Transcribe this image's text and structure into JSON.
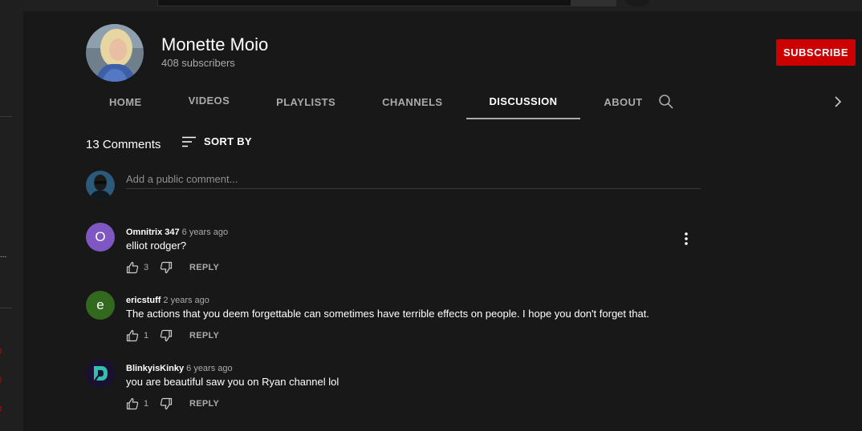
{
  "channel": {
    "name": "Monette Moio",
    "subscribers": "408 subscribers",
    "subscribe_label": "SUBSCRIBE",
    "accent_color": "#cc0000"
  },
  "tabs": [
    {
      "label": "HOME",
      "active": false
    },
    {
      "label": "VIDEOS",
      "active": false
    },
    {
      "label": "PLAYLISTS",
      "active": false
    },
    {
      "label": "CHANNELS",
      "active": false
    },
    {
      "label": "DISCUSSION",
      "active": true
    },
    {
      "label": "ABOUT",
      "active": false
    }
  ],
  "discussion": {
    "count_label": "13 Comments",
    "sort_label": "SORT BY",
    "add_comment_placeholder": "Add a public comment...",
    "reply_label": "REPLY"
  },
  "comments": [
    {
      "author": "Omnitrix 347",
      "time": "6 years ago",
      "text": "elliot rodger?",
      "likes": "3",
      "avatar_letter": "O",
      "avatar_color": "#7e57c2"
    },
    {
      "author": "ericstuff",
      "time": "2 years ago",
      "text": "The actions that you deem forgettable can sometimes have terrible effects on people. I hope you don't forget that.",
      "likes": "1",
      "avatar_letter": "e",
      "avatar_color": "#33691e"
    },
    {
      "author": "BlinkyisKinky",
      "time": "6 years ago",
      "text": "you are beautiful saw you on Ryan channel lol",
      "likes": "1",
      "avatar_letter": "",
      "avatar_color": "#1a1030"
    }
  ],
  "sidebar": {
    "ellipsis": "..."
  }
}
